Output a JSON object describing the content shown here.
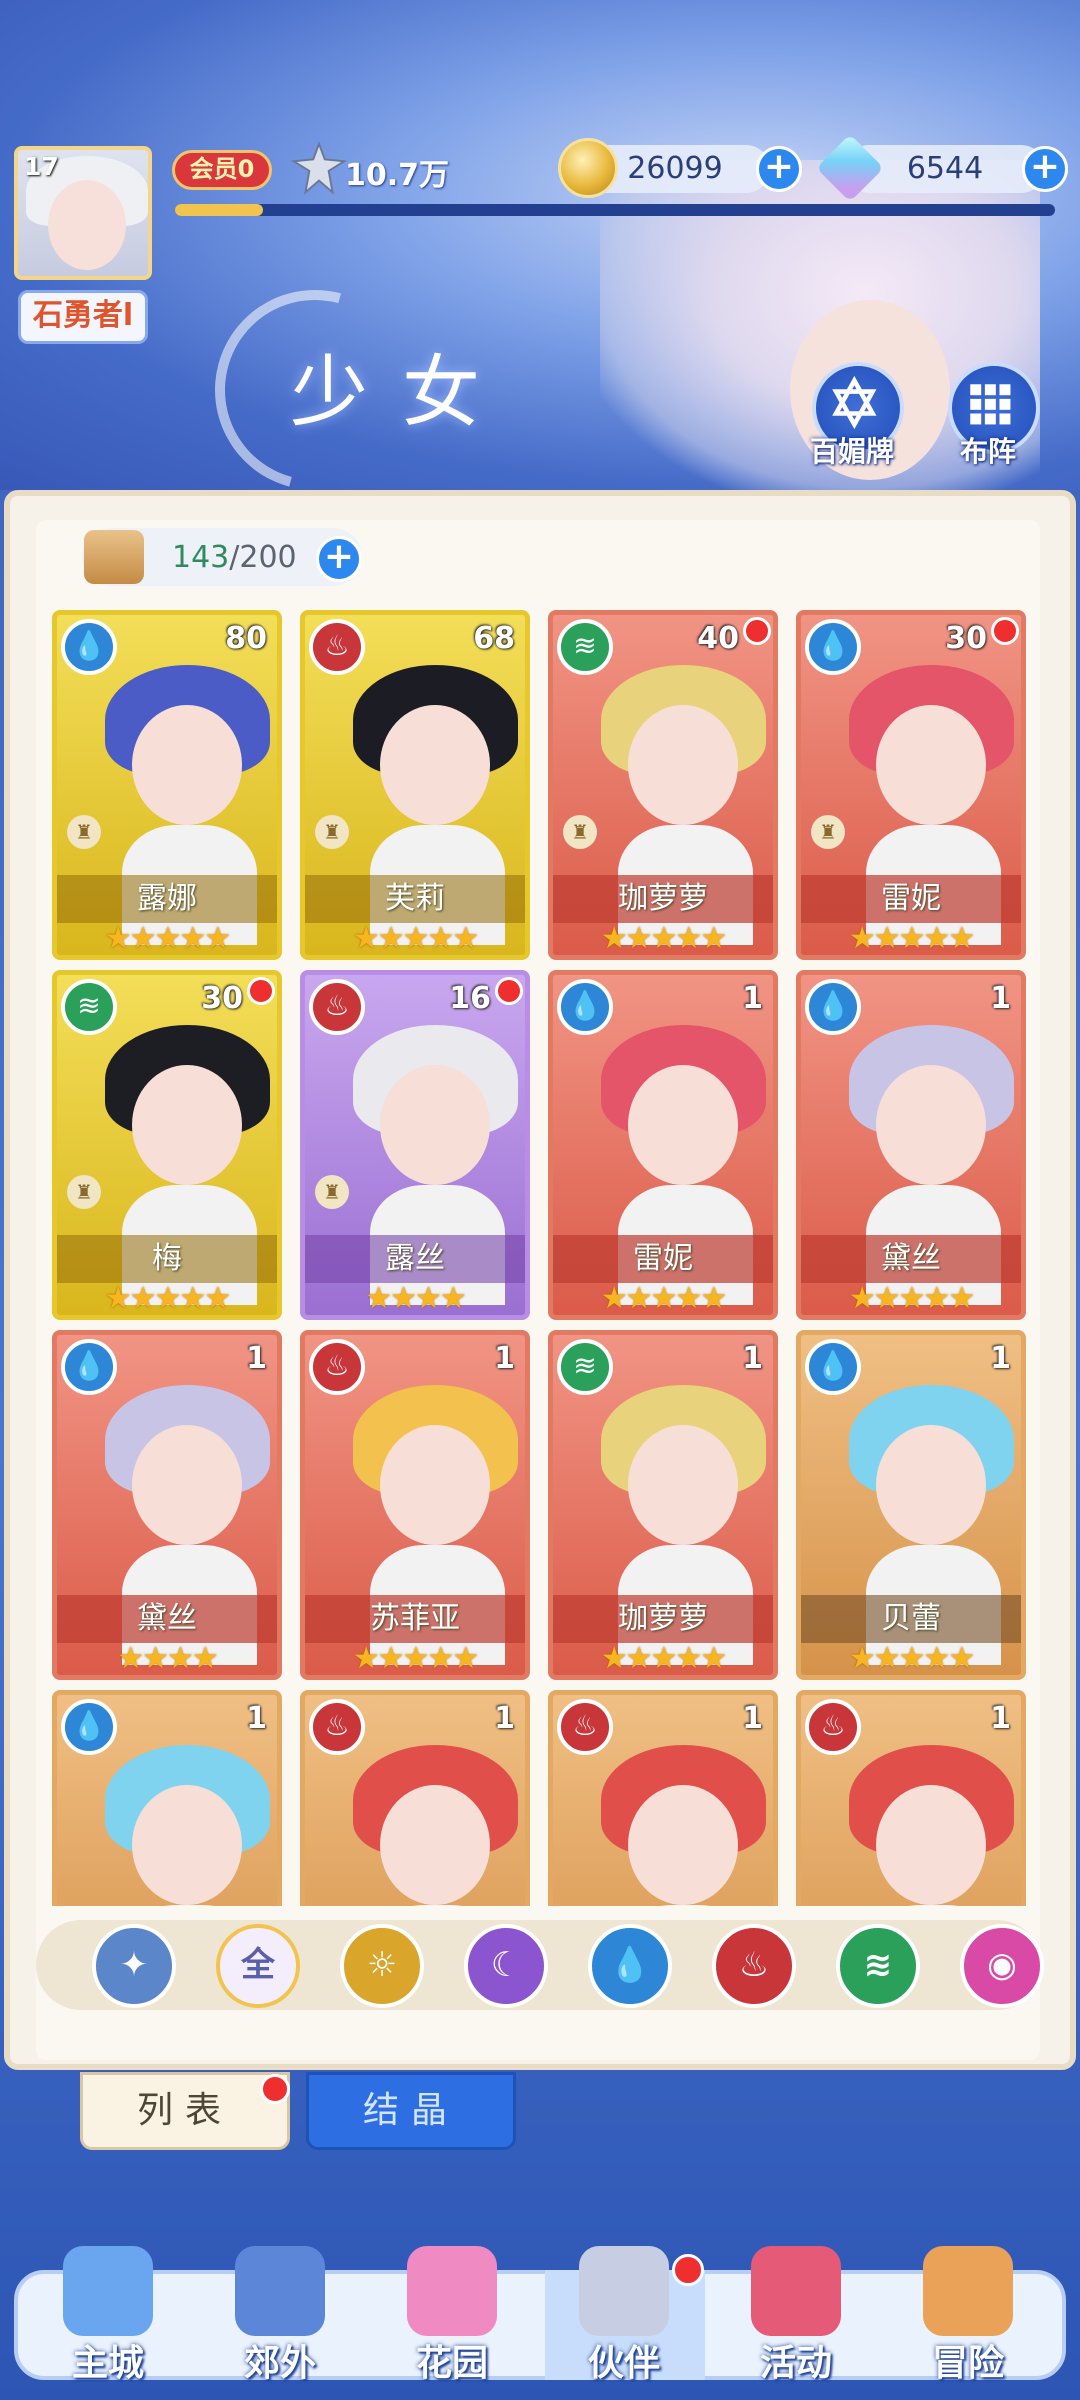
{
  "header": {
    "page_title": "少女",
    "player": {
      "level": "17",
      "name": "石勇者l",
      "vip": "会员0",
      "power": "10.7万",
      "xp_progress": 0.1
    },
    "coins": "26099",
    "gems": "6544",
    "buttons": {
      "bamei": "百媚牌",
      "formation": "布阵"
    }
  },
  "inventory": {
    "current": "143",
    "capacity": "/200"
  },
  "cards": [
    {
      "name": "露娜",
      "level": "80",
      "element": "water",
      "rarity": "gold",
      "stars": 5,
      "badge": true,
      "dot": false,
      "hair": "#4b5cc6"
    },
    {
      "name": "芙莉",
      "level": "68",
      "element": "fire",
      "rarity": "gold",
      "stars": 5,
      "badge": true,
      "dot": false,
      "hair": "#1c1c24"
    },
    {
      "name": "珈萝萝",
      "level": "40",
      "element": "wind",
      "rarity": "red",
      "stars": 5,
      "badge": true,
      "dot": true,
      "hair": "#e8d27c"
    },
    {
      "name": "雷妮",
      "level": "30",
      "element": "water",
      "rarity": "red",
      "stars": 5,
      "badge": true,
      "dot": true,
      "hair": "#e4556a"
    },
    {
      "name": "梅",
      "level": "30",
      "element": "wind",
      "rarity": "gold",
      "stars": 5,
      "badge": true,
      "dot": true,
      "hair": "#1d1d24"
    },
    {
      "name": "露丝",
      "level": "16",
      "element": "fire",
      "rarity": "purple",
      "stars": 4,
      "badge": true,
      "dot": true,
      "hair": "#e9e9ee"
    },
    {
      "name": "雷妮",
      "level": "1",
      "element": "water",
      "rarity": "red",
      "stars": 5,
      "badge": false,
      "dot": false,
      "hair": "#e4556a"
    },
    {
      "name": "黛丝",
      "level": "1",
      "element": "water",
      "rarity": "red",
      "stars": 5,
      "badge": false,
      "dot": false,
      "hair": "#c8c4e6"
    },
    {
      "name": "黛丝",
      "level": "1",
      "element": "water",
      "rarity": "red",
      "stars": 4,
      "badge": false,
      "dot": false,
      "hair": "#c8c4e6"
    },
    {
      "name": "苏菲亚",
      "level": "1",
      "element": "fire",
      "rarity": "red",
      "stars": 5,
      "badge": false,
      "dot": false,
      "hair": "#f2c14e"
    },
    {
      "name": "珈萝萝",
      "level": "1",
      "element": "wind",
      "rarity": "red",
      "stars": 5,
      "badge": false,
      "dot": false,
      "hair": "#e8d27c"
    },
    {
      "name": "贝蕾",
      "level": "1",
      "element": "water",
      "rarity": "orange",
      "stars": 5,
      "badge": false,
      "dot": false,
      "hair": "#7fd3ee"
    },
    {
      "name": "",
      "level": "1",
      "element": "water",
      "rarity": "orange",
      "stars": 0,
      "badge": false,
      "dot": false,
      "hair": "#7fd3ee"
    },
    {
      "name": "",
      "level": "1",
      "element": "fire",
      "rarity": "orange",
      "stars": 0,
      "badge": false,
      "dot": false,
      "hair": "#e04f4a"
    },
    {
      "name": "",
      "level": "1",
      "element": "fire",
      "rarity": "orange",
      "stars": 0,
      "badge": false,
      "dot": false,
      "hair": "#e04f4a"
    },
    {
      "name": "",
      "level": "1",
      "element": "fire",
      "rarity": "orange",
      "stars": 0,
      "badge": false,
      "dot": false,
      "hair": "#e04f4a"
    }
  ],
  "filters": [
    {
      "icon": "sort-icon",
      "label": "✦",
      "color": "#5b86c9"
    },
    {
      "icon": "all-filter-icon",
      "label": "全",
      "color": "#f4eefc"
    },
    {
      "icon": "light-element-icon",
      "label": "☼",
      "color": "#d9a52a"
    },
    {
      "icon": "dark-element-icon",
      "label": "☾",
      "color": "#8b55cf"
    },
    {
      "icon": "water-element-icon",
      "label": "💧",
      "color": "#2e86d6"
    },
    {
      "icon": "fire-element-icon",
      "label": "♨",
      "color": "#c8363a"
    },
    {
      "icon": "wind-element-icon",
      "label": "≋",
      "color": "#2aa05a"
    },
    {
      "icon": "magic-element-icon",
      "label": "◉",
      "color": "#d94aa6"
    }
  ],
  "tabs": {
    "list": "列表",
    "crystal": "结晶"
  },
  "nav": [
    {
      "label": "主城",
      "icon": "castle-icon",
      "color": "#6aa6f0"
    },
    {
      "label": "郊外",
      "icon": "magic-circle-icon",
      "color": "#5c87d9"
    },
    {
      "label": "花园",
      "icon": "heart-icon",
      "color": "#f08ac2"
    },
    {
      "label": "伙伴",
      "icon": "partner-icon",
      "color": "#c7cde2"
    },
    {
      "label": "活动",
      "icon": "gift-icon",
      "color": "#e55a77"
    },
    {
      "label": "冒险",
      "icon": "compass-icon",
      "color": "#e9a257"
    }
  ],
  "element_colors": {
    "water": "#2e86d6",
    "fire": "#c8363a",
    "wind": "#2aa05a"
  }
}
